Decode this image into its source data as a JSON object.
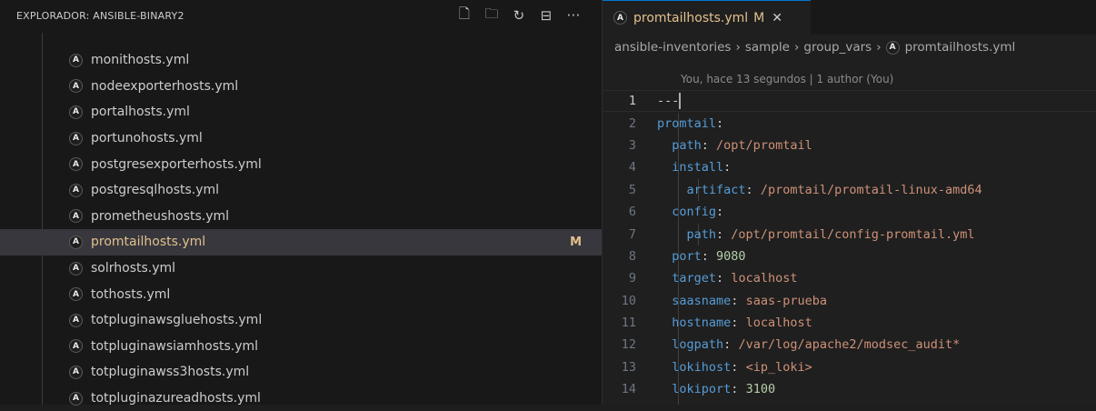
{
  "explorer": {
    "title": "EXPLORADOR: ANSIBLE-BINARY2",
    "actions": [
      {
        "name": "new-file-icon",
        "glyph": "🗋"
      },
      {
        "name": "new-folder-icon",
        "glyph": "🗀"
      },
      {
        "name": "refresh-icon",
        "glyph": "↻"
      },
      {
        "name": "collapse-all-icon",
        "glyph": "⊟"
      },
      {
        "name": "more-actions-icon",
        "glyph": "···"
      }
    ],
    "files": [
      {
        "name": "monithosts.yml",
        "status": ""
      },
      {
        "name": "nodeexporterhosts.yml",
        "status": ""
      },
      {
        "name": "portalhosts.yml",
        "status": ""
      },
      {
        "name": "portunohosts.yml",
        "status": ""
      },
      {
        "name": "postgresexporterhosts.yml",
        "status": ""
      },
      {
        "name": "postgresqlhosts.yml",
        "status": ""
      },
      {
        "name": "prometheushosts.yml",
        "status": ""
      },
      {
        "name": "promtailhosts.yml",
        "status": "M"
      },
      {
        "name": "solrhosts.yml",
        "status": ""
      },
      {
        "name": "tothosts.yml",
        "status": ""
      },
      {
        "name": "totpluginawsgluehosts.yml",
        "status": ""
      },
      {
        "name": "totpluginawsiamhosts.yml",
        "status": ""
      },
      {
        "name": "totpluginawss3hosts.yml",
        "status": ""
      },
      {
        "name": "totpluginazureadhosts.yml",
        "status": ""
      }
    ],
    "selected_index": 7,
    "file_icon_letter": "A"
  },
  "editor": {
    "tab": {
      "name": "promtailhosts.yml",
      "status": "M",
      "close": "✕",
      "icon_letter": "A"
    },
    "breadcrumb": {
      "parts": [
        "ansible-inventories",
        "sample",
        "group_vars"
      ],
      "file": "promtailhosts.yml",
      "separator": "›"
    },
    "blame": "You, hace 13 segundos | 1 author (You)",
    "lines": [
      {
        "num": "1",
        "indent": "",
        "key": "",
        "sep": "---",
        "value": "",
        "vtype": "p",
        "current": true
      },
      {
        "num": "2",
        "indent": "",
        "key": "promtail",
        "sep": ":",
        "value": "",
        "vtype": "v"
      },
      {
        "num": "3",
        "indent": "  ",
        "key": "path",
        "sep": ": ",
        "value": "/opt/promtail",
        "vtype": "v"
      },
      {
        "num": "4",
        "indent": "  ",
        "key": "install",
        "sep": ":",
        "value": "",
        "vtype": "v"
      },
      {
        "num": "5",
        "indent": "    ",
        "key": "artifact",
        "sep": ": ",
        "value": "/promtail/promtail-linux-amd64",
        "vtype": "v"
      },
      {
        "num": "6",
        "indent": "  ",
        "key": "config",
        "sep": ":",
        "value": "",
        "vtype": "v"
      },
      {
        "num": "7",
        "indent": "    ",
        "key": "path",
        "sep": ": ",
        "value": "/opt/promtail/config-promtail.yml",
        "vtype": "v"
      },
      {
        "num": "8",
        "indent": "  ",
        "key": "port",
        "sep": ": ",
        "value": "9080",
        "vtype": "n"
      },
      {
        "num": "9",
        "indent": "  ",
        "key": "target",
        "sep": ": ",
        "value": "localhost",
        "vtype": "v"
      },
      {
        "num": "10",
        "indent": "  ",
        "key": "saasname",
        "sep": ": ",
        "value": "saas-prueba",
        "vtype": "v"
      },
      {
        "num": "11",
        "indent": "  ",
        "key": "hostname",
        "sep": ": ",
        "value": "localhost",
        "vtype": "v"
      },
      {
        "num": "12",
        "indent": "  ",
        "key": "logpath",
        "sep": ": ",
        "value": "/var/log/apache2/modsec_audit*",
        "vtype": "v"
      },
      {
        "num": "13",
        "indent": "  ",
        "key": "lokihost",
        "sep": ": ",
        "value": "<ip_loki>",
        "vtype": "v"
      },
      {
        "num": "14",
        "indent": "  ",
        "key": "lokiport",
        "sep": ": ",
        "value": "3100",
        "vtype": "n"
      }
    ]
  },
  "colors": {
    "modified": "#e2c08d",
    "key": "#569cd6",
    "string": "#ce9178",
    "number": "#b5cea8",
    "selection": "#37373d",
    "tab_border": "#0078d4"
  }
}
